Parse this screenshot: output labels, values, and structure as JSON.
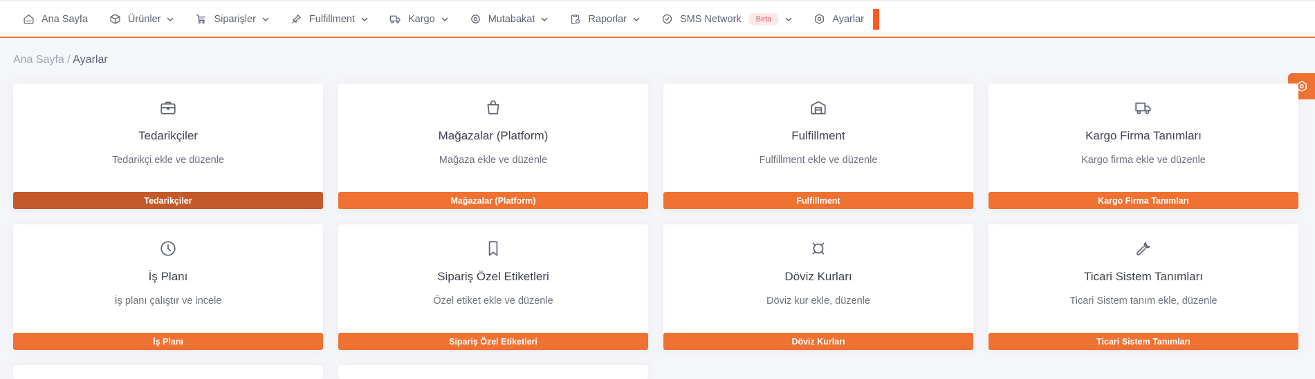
{
  "nav": [
    {
      "label": "Ana Sayfa",
      "icon": "home-icon",
      "dropdown": false
    },
    {
      "label": "Ürünler",
      "icon": "box-icon",
      "dropdown": true
    },
    {
      "label": "Siparişler",
      "icon": "orders-icon",
      "dropdown": true
    },
    {
      "label": "Fulfillment",
      "icon": "pin-icon",
      "dropdown": true
    },
    {
      "label": "Kargo",
      "icon": "truck-icon",
      "dropdown": true
    },
    {
      "label": "Mutabakat",
      "icon": "target-icon",
      "dropdown": true
    },
    {
      "label": "Raporlar",
      "icon": "report-icon",
      "dropdown": true
    },
    {
      "label": "SMS Network",
      "icon": "check-circle-icon",
      "dropdown": true,
      "badge": "Beta"
    },
    {
      "label": "Ayarlar",
      "icon": "settings-icon",
      "dropdown": false
    }
  ],
  "breadcrumb": {
    "home": "Ana Sayfa",
    "separator": " / ",
    "current": "Ayarlar"
  },
  "cards": [
    {
      "title": "Tedarikçiler",
      "desc": "Tedarikçi ekle ve düzenle",
      "button": "Tedarikçiler",
      "icon": "briefcase-icon"
    },
    {
      "title": "Mağazalar (Platform)",
      "desc": "Mağaza ekle ve düzenle",
      "button": "Mağazalar (Platform)",
      "icon": "shopping-bag-icon"
    },
    {
      "title": "Fulfillment",
      "desc": "Fulfillment ekle ve düzenle",
      "button": "Fulfillment",
      "icon": "warehouse-icon"
    },
    {
      "title": "Kargo Firma Tanımları",
      "desc": "Kargo firma ekle ve düzenle",
      "button": "Kargo Firma Tanımları",
      "icon": "truck-icon"
    },
    {
      "title": "İş Planı",
      "desc": "İş planı çalıştır ve incele",
      "button": "İş Planı",
      "icon": "clock-icon"
    },
    {
      "title": "Sipariş Özel Etiketleri",
      "desc": "Özel etiket ekle ve düzenle",
      "button": "Sipariş Özel Etiketleri",
      "icon": "bookmark-icon"
    },
    {
      "title": "Döviz Kurları",
      "desc": "Döviz kur ekle, düzenle",
      "button": "Döviz Kurları",
      "icon": "currency-icon"
    },
    {
      "title": "Ticari Sistem Tanımları",
      "desc": "Ticari Sistem tanım ekle, düzenle",
      "button": "Ticari Sistem Tanımları",
      "icon": "wrench-icon"
    }
  ],
  "colors": {
    "accent": "#ef7233",
    "accent_active": "#c45a2a",
    "badge_bg": "#fde8ea",
    "badge_text": "#e15b6a"
  }
}
